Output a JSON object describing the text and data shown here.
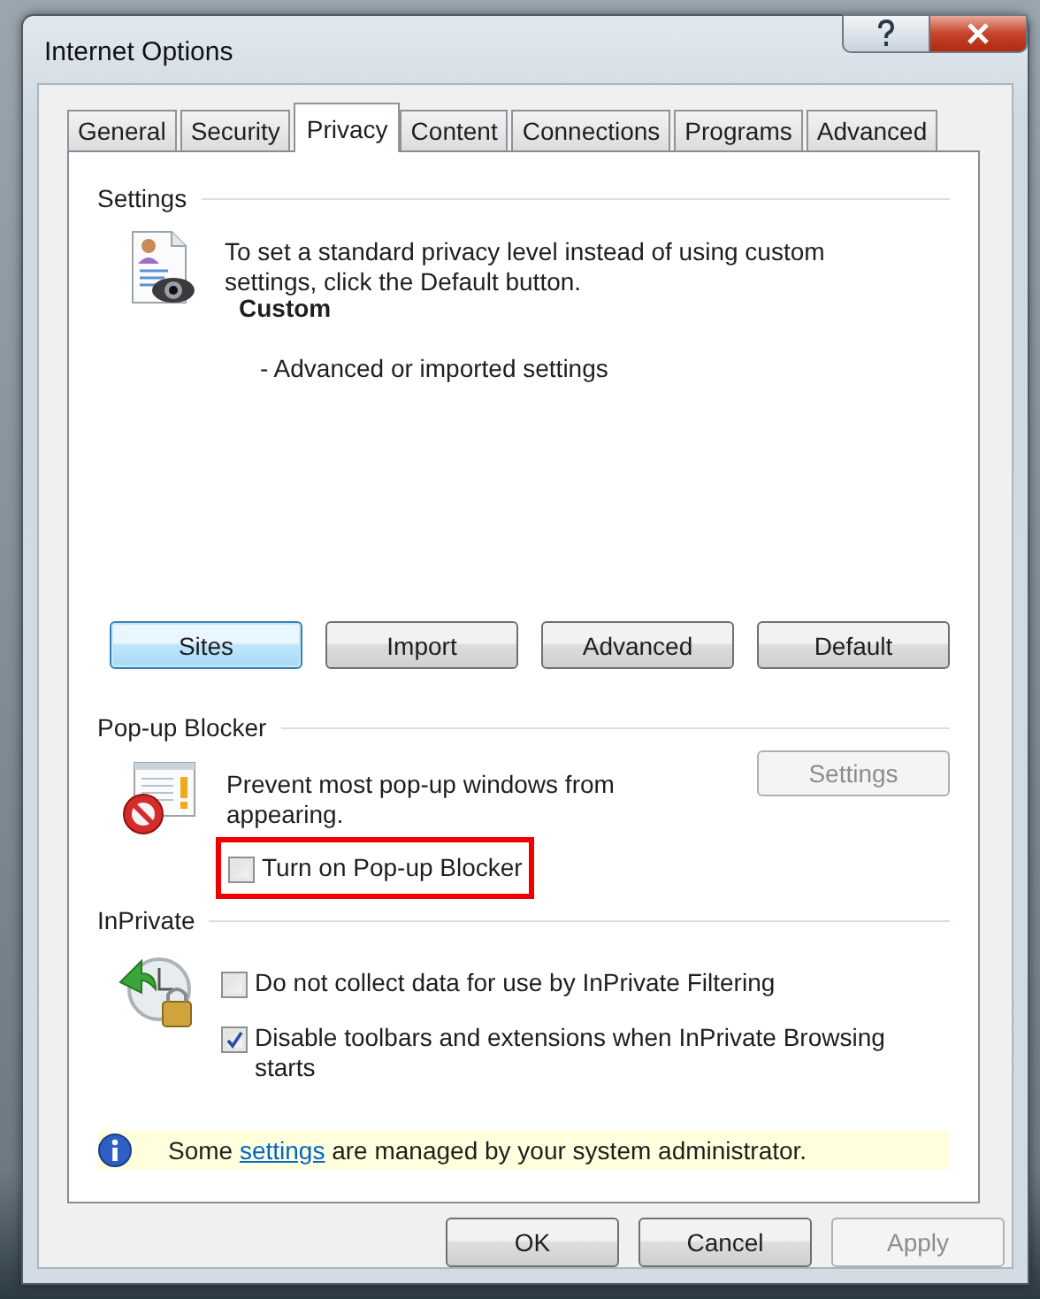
{
  "window": {
    "title": "Internet Options"
  },
  "tabs": [
    {
      "label": "General",
      "selected": false
    },
    {
      "label": "Security",
      "selected": false
    },
    {
      "label": "Privacy",
      "selected": true
    },
    {
      "label": "Content",
      "selected": false
    },
    {
      "label": "Connections",
      "selected": false
    },
    {
      "label": "Programs",
      "selected": false
    },
    {
      "label": "Advanced",
      "selected": false
    }
  ],
  "privacy": {
    "legend": "Settings",
    "description": "To set a standard privacy level instead of using custom settings, click the Default button.",
    "level": "Custom",
    "level_detail": "- Advanced or imported settings",
    "buttons": [
      {
        "label": "Sites",
        "focused": true
      },
      {
        "label": "Import",
        "focused": false
      },
      {
        "label": "Advanced",
        "focused": false
      },
      {
        "label": "Default",
        "focused": false
      }
    ]
  },
  "popup_blocker": {
    "legend": "Pop-up Blocker",
    "description": "Prevent most pop-up windows from appearing.",
    "settings_button": {
      "label": "Settings",
      "disabled": true
    },
    "checkbox": {
      "label": "Turn on Pop-up Blocker",
      "checked": false,
      "highlighted": true
    }
  },
  "inprivate": {
    "legend": "InPrivate",
    "options": [
      {
        "label": "Do not collect data for use by InPrivate Filtering",
        "checked": false
      },
      {
        "label": "Disable toolbars and extensions when InPrivate Browsing starts",
        "checked": true
      }
    ]
  },
  "info_bar": {
    "text_before": "Some",
    "link": "settings",
    "text_after": "are managed by your system administrator."
  },
  "buttons": [
    {
      "label": "OK",
      "disabled": false
    },
    {
      "label": "Cancel",
      "disabled": false
    },
    {
      "label": "Apply",
      "disabled": true
    }
  ]
}
